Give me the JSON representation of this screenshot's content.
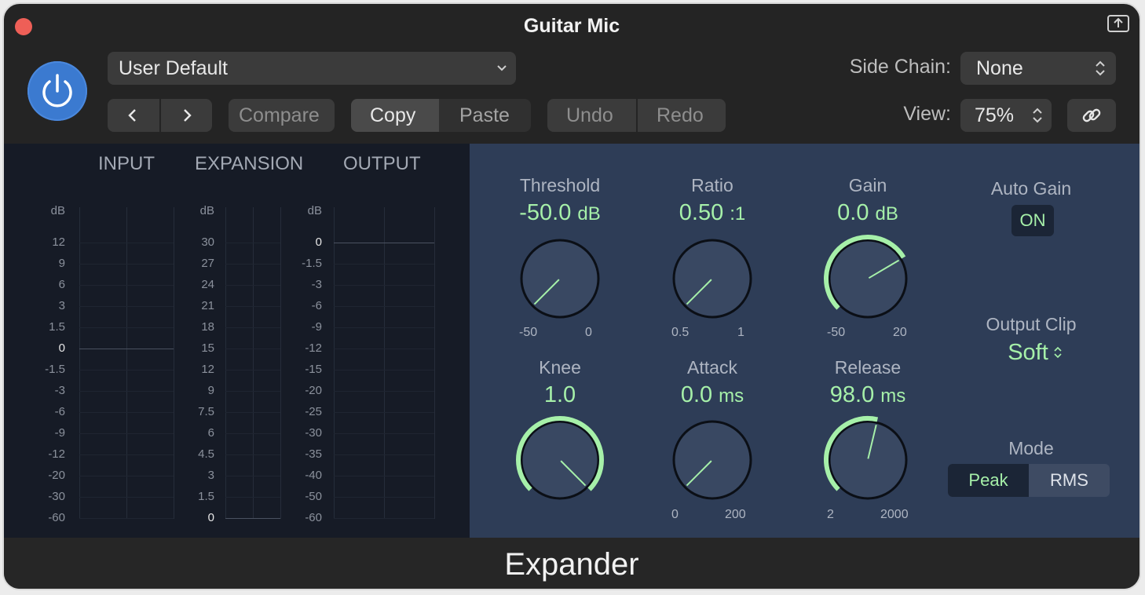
{
  "window": {
    "title": "Guitar Mic"
  },
  "toolbar": {
    "preset": "User Default",
    "compare": "Compare",
    "copy": "Copy",
    "paste": "Paste",
    "undo": "Undo",
    "redo": "Redo",
    "side_chain_label": "Side Chain:",
    "side_chain_value": "None",
    "view_label": "View:",
    "view_value": "75%"
  },
  "meters": {
    "input": {
      "header": "INPUT",
      "unit": "dB",
      "ticks": [
        "12",
        "9",
        "6",
        "3",
        "1.5",
        "0",
        "-1.5",
        "-3",
        "-6",
        "-9",
        "-12",
        "-20",
        "-30",
        "-60"
      ]
    },
    "expansion": {
      "header": "EXPANSION",
      "unit": "dB",
      "ticks": [
        "30",
        "27",
        "24",
        "21",
        "18",
        "15",
        "12",
        "9",
        "7.5",
        "6",
        "4.5",
        "3",
        "1.5",
        "0"
      ]
    },
    "output": {
      "header": "OUTPUT",
      "unit": "dB",
      "ticks": [
        "0",
        "-1.5",
        "-3",
        "-6",
        "-9",
        "-12",
        "-15",
        "-20",
        "-25",
        "-30",
        "-35",
        "-40",
        "-50",
        "-60"
      ]
    }
  },
  "params": {
    "threshold": {
      "label": "Threshold",
      "value": "-50.0",
      "unit": "dB",
      "min": "-50",
      "max": "0",
      "norm": 0.0
    },
    "ratio": {
      "label": "Ratio",
      "value": "0.50",
      "unit": ":1",
      "min": "0.5",
      "max": "1",
      "norm": 0.0
    },
    "gain": {
      "label": "Gain",
      "value": "0.0",
      "unit": "dB",
      "min": "-50",
      "max": "20",
      "norm": 0.72
    },
    "knee": {
      "label": "Knee",
      "value": "1.0",
      "unit": "",
      "min": "",
      "max": "",
      "norm": 1.0
    },
    "attack": {
      "label": "Attack",
      "value": "0.0",
      "unit": "ms",
      "min": "0",
      "max": "200",
      "norm": 0.0
    },
    "release": {
      "label": "Release",
      "value": "98.0",
      "unit": "ms",
      "min": "2",
      "max": "2000",
      "norm": 0.55
    }
  },
  "auto_gain": {
    "label": "Auto Gain",
    "state": "ON"
  },
  "output_clip": {
    "label": "Output Clip",
    "value": "Soft"
  },
  "mode": {
    "label": "Mode",
    "options": [
      "Peak",
      "RMS"
    ],
    "selected": "Peak"
  },
  "footer": {
    "plugin_name": "Expander"
  },
  "colors": {
    "accent": "#a6f0a9",
    "power": "#3b7ad0",
    "panel": "#2e3d57",
    "meter_bg": "#161b26"
  },
  "icons": [
    "power-icon",
    "chevron-down-icon",
    "chevron-left-icon",
    "chevron-right-icon",
    "updown-chevron-icon",
    "link-icon",
    "expand-window-icon"
  ]
}
